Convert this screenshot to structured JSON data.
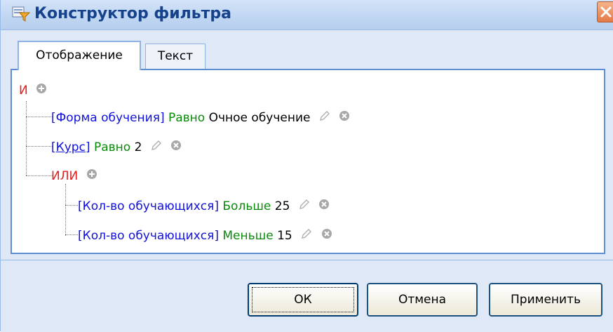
{
  "window": {
    "title": "Конструктор фильтра"
  },
  "tabs": [
    {
      "label": "Отображение",
      "active": true
    },
    {
      "label": "Текст",
      "active": false
    }
  ],
  "tree": {
    "root_operator": "И",
    "conditions": [
      {
        "field": "[Форма обучения]",
        "operator": "Равно",
        "value": "Очное обучение"
      },
      {
        "field": "[Курс]",
        "operator": "Равно",
        "value": "2"
      }
    ],
    "group": {
      "operator": "ИЛИ",
      "conditions": [
        {
          "field": "[Кол-во обучающихся]",
          "operator": "Больше",
          "value": "25"
        },
        {
          "field": "[Кол-во обучающихся]",
          "operator": "Меньше",
          "value": "15"
        }
      ]
    }
  },
  "buttons": {
    "ok": "ОК",
    "cancel": "Отмена",
    "apply": "Применить"
  },
  "icons": {
    "title": "filter-builder-icon",
    "close": "close-icon",
    "add": "add-icon",
    "edit": "edit-pencil-icon",
    "remove": "remove-icon"
  },
  "colors": {
    "operator": "#e02020",
    "field": "#1111dd",
    "condition": "#0a8a0a"
  }
}
